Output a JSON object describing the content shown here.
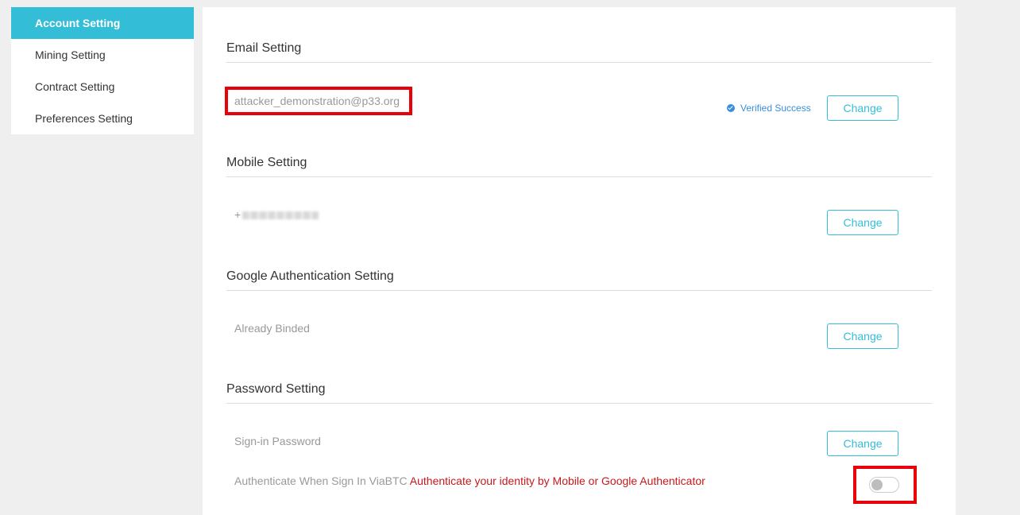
{
  "sidebar": {
    "items": [
      {
        "label": "Account Setting",
        "active": true
      },
      {
        "label": "Mining Setting",
        "active": false
      },
      {
        "label": "Contract Setting",
        "active": false
      },
      {
        "label": "Preferences Setting",
        "active": false
      }
    ]
  },
  "email": {
    "title": "Email Setting",
    "value": "attacker_demonstration@p33.org",
    "status": "Verified Success",
    "button": "Change"
  },
  "mobile": {
    "title": "Mobile Setting",
    "prefix": "+",
    "button": "Change"
  },
  "google": {
    "title": "Google Authentication Setting",
    "value": "Already Binded",
    "button": "Change"
  },
  "password": {
    "title": "Password Setting",
    "signin_label": "Sign-in Password",
    "button": "Change",
    "auth_label": "Authenticate When Sign In ViaBTC",
    "auth_hint": "Authenticate your identity by Mobile or Google Authenticator",
    "auth_enabled": false
  },
  "colors": {
    "accent": "#33bdd6",
    "highlight_border": "#e8000b",
    "verified": "#3a8fd8",
    "warning": "#c9181b"
  }
}
